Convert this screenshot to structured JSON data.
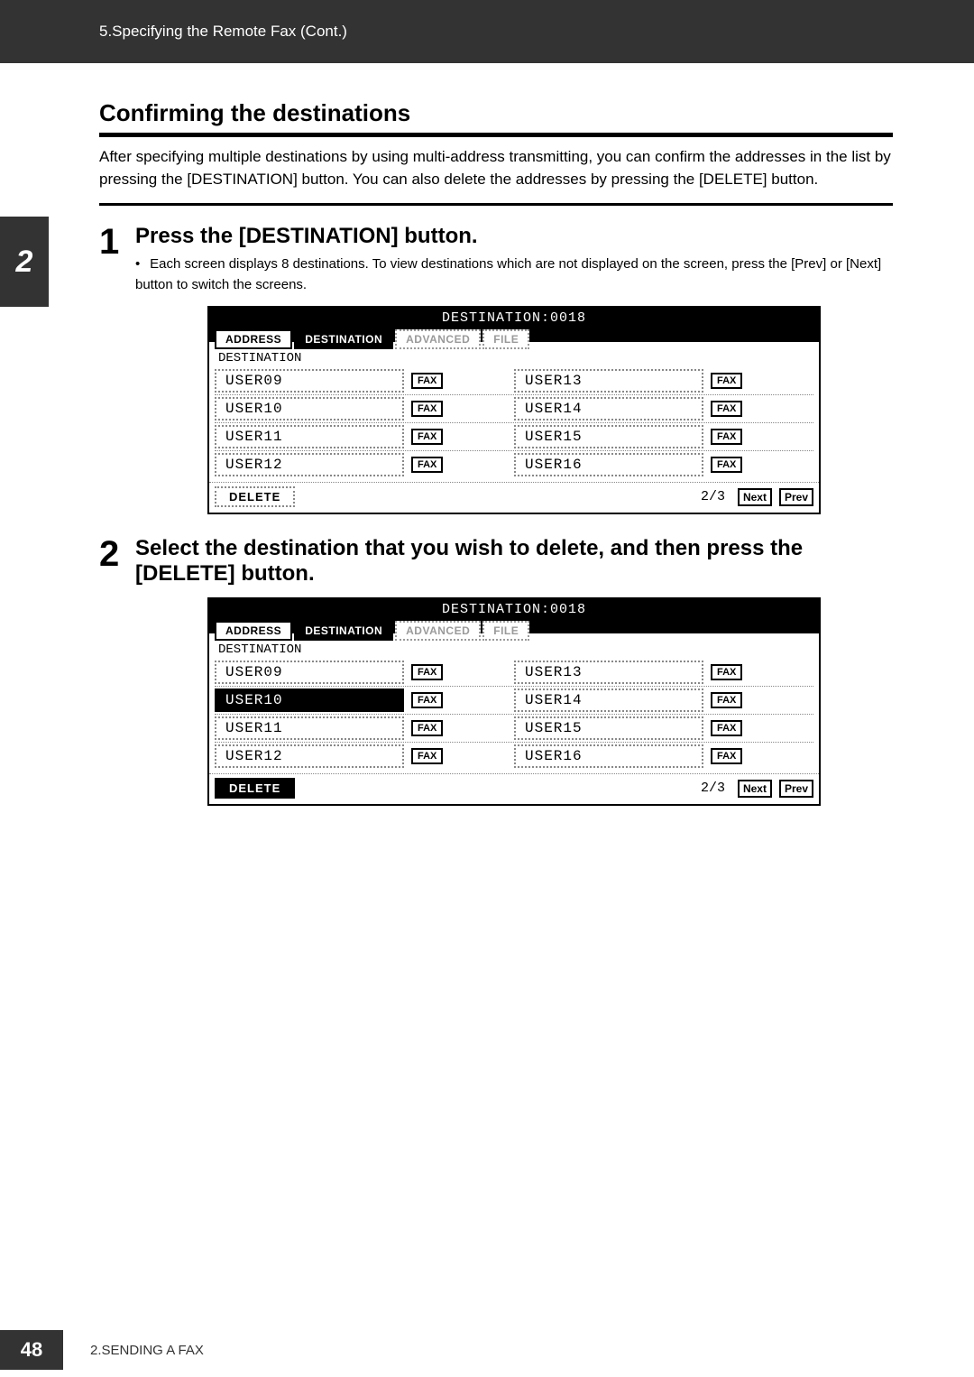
{
  "header": {
    "breadcrumb": "5.Specifying the Remote Fax (Cont.)"
  },
  "side_tab": "2",
  "section": {
    "title": "Confirming the destinations",
    "intro": "After specifying multiple destinations by using multi-address transmitting, you can confirm the addresses in the list by pressing the [DESTINATION] button. You can also delete the addresses by pressing the [DELETE] button."
  },
  "steps": [
    {
      "num": "1",
      "title": "Press the [DESTINATION] button.",
      "note": "Each screen displays 8 destinations. To view destinations which are not displayed on the screen, press the [Prev] or [Next] button to switch the screens."
    },
    {
      "num": "2",
      "title": "Select the destination that you wish to delete, and then press the [DELETE] button.",
      "note": ""
    }
  ],
  "panel_common": {
    "title": "DESTINATION:0018",
    "tabs": [
      "ADDRESS",
      "DESTINATION",
      "ADVANCED",
      "FILE"
    ],
    "sublabel": "DESTINATION",
    "type_label": "FAX",
    "page_ind": "2/3",
    "next": "Next",
    "prev": "Prev",
    "delete": "DELETE"
  },
  "panel1": {
    "rows": [
      {
        "left": "USER09",
        "right": "USER13"
      },
      {
        "left": "USER10",
        "right": "USER14"
      },
      {
        "left": "USER11",
        "right": "USER15"
      },
      {
        "left": "USER12",
        "right": "USER16"
      }
    ],
    "selected_dest": null,
    "delete_selected": false
  },
  "panel2": {
    "rows": [
      {
        "left": "USER09",
        "right": "USER13"
      },
      {
        "left": "USER10",
        "right": "USER14"
      },
      {
        "left": "USER11",
        "right": "USER15"
      },
      {
        "left": "USER12",
        "right": "USER16"
      }
    ],
    "selected_dest": "USER10",
    "delete_selected": true
  },
  "footer": {
    "page": "48",
    "chapter": "2.SENDING A FAX"
  }
}
